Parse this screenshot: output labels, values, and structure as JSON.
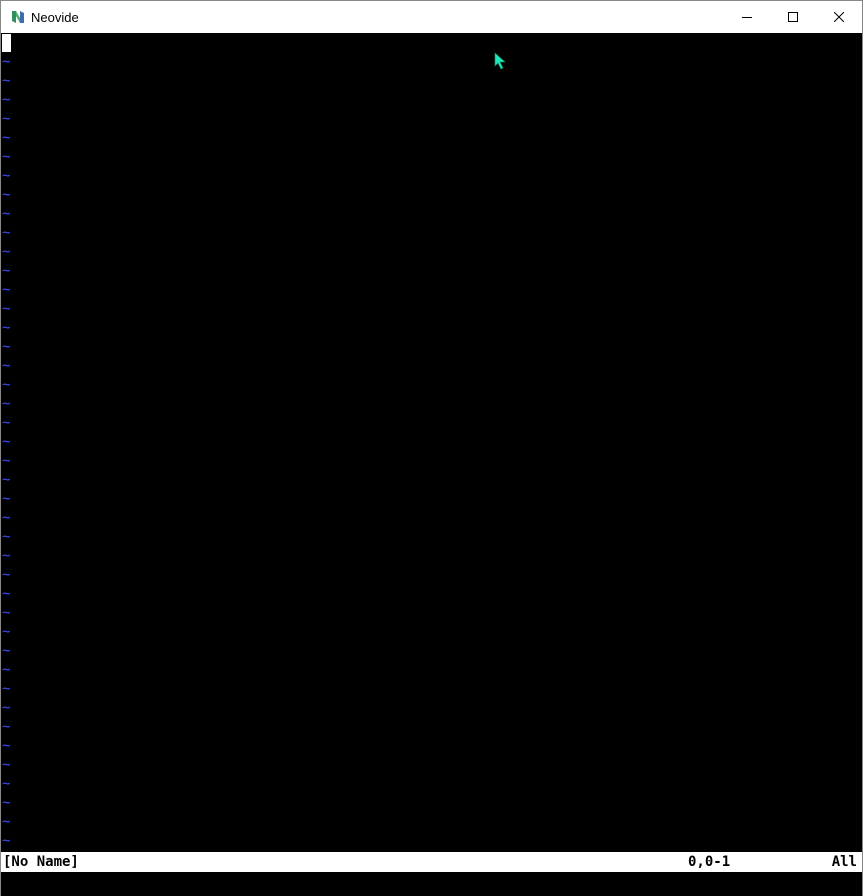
{
  "window": {
    "title": "Neovide",
    "icon": "neovide-logo-icon",
    "controls": {
      "minimize": "minimize-icon",
      "maximize": "maximize-icon",
      "close": "close-icon"
    }
  },
  "editor": {
    "empty_line_marker": "~",
    "empty_line_count": 42,
    "colors": {
      "background": "#000000",
      "tilde": "#3a4fff",
      "statusline_bg": "#ffffff",
      "statusline_fg": "#000000",
      "pointer": "#1de9b6"
    }
  },
  "statusline": {
    "file_name": "[No Name]",
    "position": "0,0-1",
    "scroll": "All"
  }
}
